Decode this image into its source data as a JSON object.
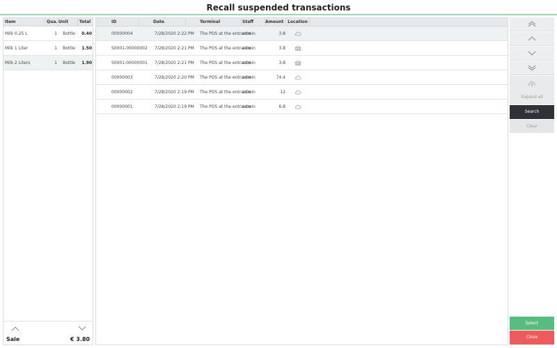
{
  "title": "Recall suspended transactions",
  "items_panel": {
    "headers": {
      "item": "Item",
      "qty": "Qua...",
      "unit": "Unit",
      "total": "Total"
    },
    "rows": [
      {
        "item": "Milk 0.25 L",
        "qty": "1",
        "unit": "Bottle",
        "total": "0.40",
        "selected": false
      },
      {
        "item": "Milk 1 Liter",
        "qty": "1",
        "unit": "Bottle",
        "total": "1.50",
        "selected": false
      },
      {
        "item": "Milk 2 Liters",
        "qty": "1",
        "unit": "Bottle",
        "total": "1.90",
        "selected": true
      }
    ],
    "footer": {
      "label": "Sale",
      "amount": "€ 3.80"
    }
  },
  "transactions": {
    "headers": {
      "id": "ID",
      "date": "Date",
      "terminal": "Terminal",
      "staff": "Staff",
      "amount": "Amount",
      "location": "Location"
    },
    "rows": [
      {
        "id": "00000004",
        "date": "7/28/2020 2:22 PM",
        "terminal": "The POS at the entrance",
        "staff": "admin",
        "amount": "3.8",
        "location": "cloud-icon",
        "selected": true
      },
      {
        "id": "S0001-00000002",
        "date": "7/28/2020 2:21 PM",
        "terminal": "The POS at the entrance",
        "staff": "admin",
        "amount": "3.8",
        "location": "store-icon",
        "selected": false
      },
      {
        "id": "S0001-00000001",
        "date": "7/28/2020 2:21 PM",
        "terminal": "The POS at the entrance",
        "staff": "admin",
        "amount": "3.8",
        "location": "store-icon",
        "selected": false
      },
      {
        "id": "00000003",
        "date": "7/28/2020 2:20 PM",
        "terminal": "The POS at the entrance",
        "staff": "admin",
        "amount": "74.4",
        "location": "cloud-icon",
        "selected": false
      },
      {
        "id": "00000002",
        "date": "7/28/2020 2:19 PM",
        "terminal": "The POS at the entrance",
        "staff": "admin",
        "amount": "12",
        "location": "cloud-icon",
        "selected": false
      },
      {
        "id": "00000001",
        "date": "7/28/2020 2:19 PM",
        "terminal": "The POS at the entrance",
        "staff": "admin",
        "amount": "6.8",
        "location": "cloud-icon",
        "selected": false
      }
    ]
  },
  "side_buttons": {
    "nav_icons": [
      "double-chevron-up-icon",
      "chevron-up-icon",
      "chevron-down-icon",
      "double-chevron-down-icon"
    ],
    "expand_all": "Expand all",
    "expand_icon": "cloud-upload-icon",
    "search": "Search",
    "clear": "Clear",
    "select": "Select",
    "close": "Close"
  },
  "colors": {
    "accent_line": "#9fd1b4",
    "search_bg": "#2f3236",
    "select_bg": "#56bd81",
    "close_bg": "#ef5a5a",
    "header_bg": "#e6e9ec",
    "selected_row_bg": "#eef2f3"
  }
}
